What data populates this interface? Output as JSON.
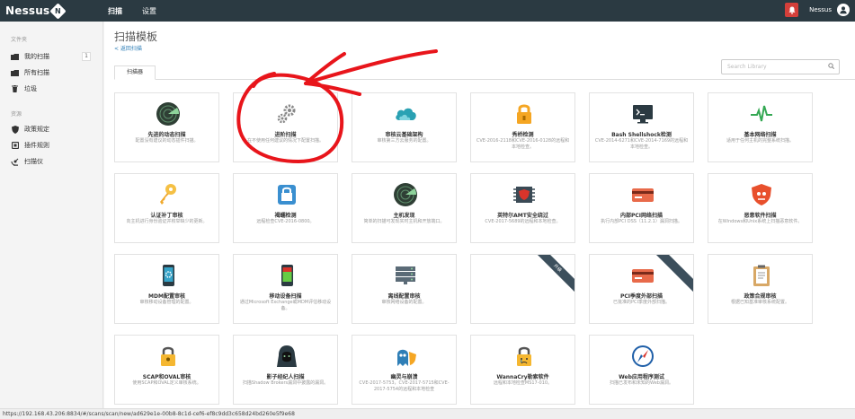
{
  "app": {
    "logo": "Nessus",
    "logo_badge": "N"
  },
  "nav": {
    "scans": "扫描",
    "settings": "设置"
  },
  "user": {
    "name": "Nessus"
  },
  "sidebar": {
    "section_folders": "文件夹",
    "my_scans": "我的扫描",
    "my_scans_count": "1",
    "all_scans": "所有扫描",
    "trash": "垃圾",
    "section_resources": "资源",
    "policies": "政策规定",
    "plugin_rules": "插件规则",
    "scanners": "扫描仪"
  },
  "main": {
    "title": "扫描模板",
    "back": "< 返回扫描",
    "tab_scanner": "扫描器",
    "search_placeholder": "Search Library"
  },
  "cards": [
    {
      "title": "先进的动态扫描",
      "desc": "配置没有建议的动态插件扫描。",
      "icon": "radar-icon"
    },
    {
      "title": "进阶扫描",
      "desc": "在不使用任何建议的情况下配置扫描。",
      "icon": "gear-icon"
    },
    {
      "title": "审核云基础架构",
      "desc": "审核第三方云服务的配置。",
      "icon": "cloud-icon"
    },
    {
      "title": "秀桥检测",
      "desc": "CVE-2016-2118和CVE-2016-0128的远程和本地检查。",
      "icon": "padlock-icon"
    },
    {
      "title": "Bash Shellshock检测",
      "desc": "CVE-2014-6271和CVE-2014-7169的远程和本地检查。",
      "icon": "terminal-icon"
    },
    {
      "title": "基本网络扫描",
      "desc": "适用于任何主机的完整系统扫描。",
      "icon": "pulse-icon"
    },
    {
      "title": "认证补丁审核",
      "desc": "向主机进行身份验证并枚举缺少的更新。",
      "icon": "keys-icon"
    },
    {
      "title": "褐蠕检测",
      "desc": "远程检查CVE-2016-0800。",
      "icon": "badlock-icon"
    },
    {
      "title": "主机发现",
      "desc": "简单的扫描可发现实时主机和开放端口。",
      "icon": "radar-icon"
    },
    {
      "title": "英特尔AMT安全绕过",
      "desc": "CVE-2017-5689的远程和本地检查。",
      "icon": "chip-icon"
    },
    {
      "title": "内部PCI网络扫描",
      "desc": "执行内部PCI DSS（11.2.1）漏洞扫描。",
      "icon": "card-icon"
    },
    {
      "title": "恶意软件扫描",
      "desc": "在Windows和Unix系统上扫描恶意软件。",
      "icon": "shield-icon"
    },
    {
      "title": "MDM配置审核",
      "desc": "审核移动设备管理的配置。",
      "icon": "phone-gear-icon"
    },
    {
      "title": "移动设备扫描",
      "desc": "通过Microsoft Exchange或MDM评估移动设备。",
      "icon": "phone-icon"
    },
    {
      "title": "离线配置审核",
      "desc": "审核网络设备的配置。",
      "icon": "server-icon"
    },
    {
      "title": "",
      "desc": "",
      "icon": "",
      "ribbon": "升级"
    },
    {
      "title": "PCI季度外部扫描",
      "desc": "已批准的PCI季度外部扫描。",
      "icon": "card-icon",
      "ribbon": ""
    },
    {
      "title": "政策合规审核",
      "desc": "根据已知基准审核系统配置。",
      "icon": "clipboard-icon"
    },
    {
      "title": "SCAP和OVAL审核",
      "desc": "使用SCAP和OVAL定义审核系统。",
      "icon": "lock-icon"
    },
    {
      "title": "影子经纪人扫描",
      "desc": "扫描Shadow Brokers漏洞中披露的漏洞。",
      "icon": "hacker-icon"
    },
    {
      "title": "幽灵与崩溃",
      "desc": "CVE-2017-5753，CVE-2017-5715和CVE-2017-5754的远程和本地检查",
      "icon": "ghost-icon"
    },
    {
      "title": "WannaCry勒索软件",
      "desc": "远程和本地检查MS17-010。",
      "icon": "wannacry-icon"
    },
    {
      "title": "Web应用程序测试",
      "desc": "扫描已发布和未知的Web漏洞。",
      "icon": "compass-icon"
    }
  ],
  "status": {
    "url": "https://192.168.43.206:8834/#/scans/scan/new/ad629e1e-00b8-8c1d-cef6-ef8c9dd3c658d24bd260e5f9e68"
  },
  "colors": {
    "topbar": "#2b3a42",
    "accent": "#2f7fb7",
    "alert": "#d43f3a",
    "annotation": "#e8151b"
  }
}
